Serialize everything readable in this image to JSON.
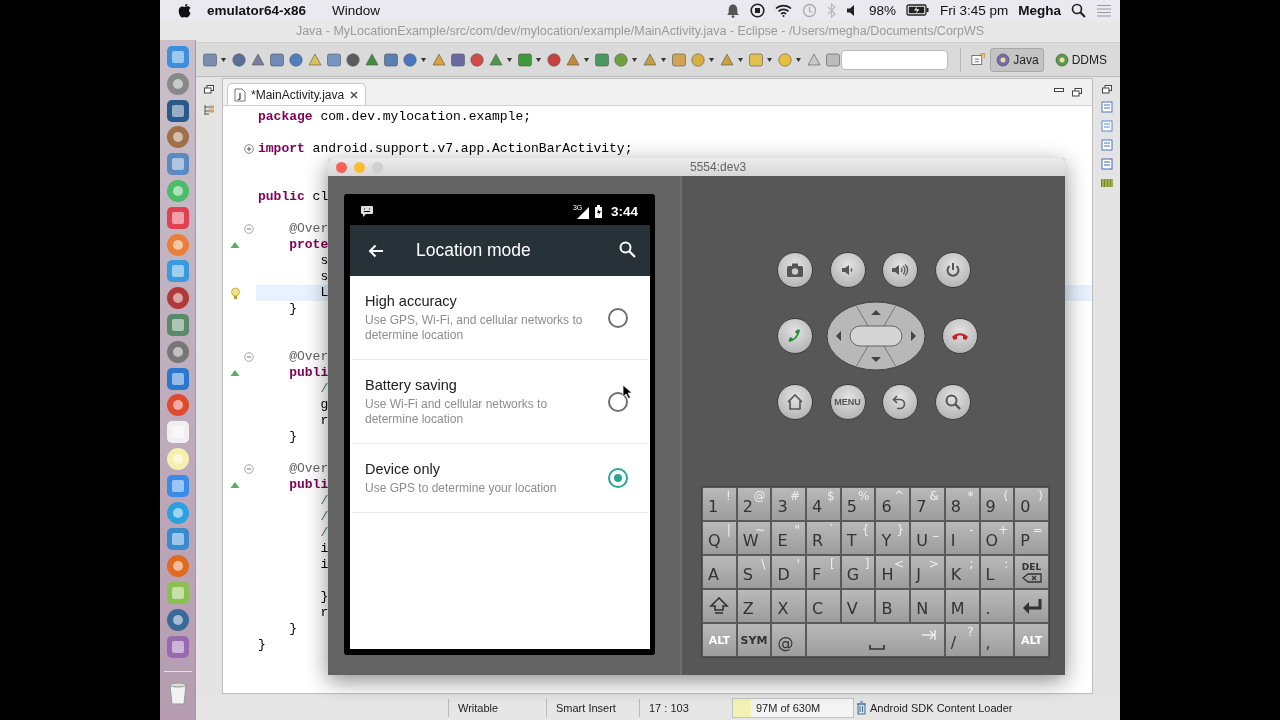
{
  "menu_bar": {
    "app_name": "emulator64-x86",
    "menus": [
      "Window"
    ],
    "battery": "98%",
    "clock": "Fri 3:45 pm",
    "user": "Megha"
  },
  "eclipse": {
    "title": "Java - MyLocationExample/src/com/dev/mylocation/example/MainActivity.java - Eclipse - /Users/megha/Documents/CorpWS",
    "perspectives": [
      {
        "label": "Java",
        "selected": true
      },
      {
        "label": "DDMS",
        "selected": false
      }
    ],
    "editor_tab": {
      "label": "*MainActivity.java"
    },
    "code_lines": [
      {
        "kind": "code",
        "text": "**package** com.dev.mylocation.example;",
        "current": false
      },
      {
        "kind": "blank",
        "current": false
      },
      {
        "kind": "code",
        "text": "**import** android.support.v7.app.ActionBarActivity;",
        "folded": true,
        "current": false
      },
      {
        "kind": "blank",
        "current": false
      },
      {
        "kind": "blank",
        "current": false
      },
      {
        "kind": "code",
        "text": "**public** cl",
        "current": false
      },
      {
        "kind": "blank",
        "current": false
      },
      {
        "kind": "annotation",
        "text": "    @Over",
        "folded": false,
        "current": false
      },
      {
        "kind": "code",
        "text": "    **prote**",
        "override": true,
        "current": false
      },
      {
        "kind": "code",
        "text": "        s",
        "current": false
      },
      {
        "kind": "code",
        "text": "        s",
        "current": false
      },
      {
        "kind": "code",
        "text": "        L",
        "warning": true,
        "current": true
      },
      {
        "kind": "code",
        "text": "    }",
        "current": false
      },
      {
        "kind": "blank",
        "current": false
      },
      {
        "kind": "blank",
        "current": false
      },
      {
        "kind": "annotation",
        "text": "    @Over",
        "folded": false,
        "current": false
      },
      {
        "kind": "code",
        "text": "    **publi**",
        "override": true,
        "current": false
      },
      {
        "kind": "comment",
        "text": "        /",
        "current": false
      },
      {
        "kind": "code",
        "text": "        g",
        "current": false
      },
      {
        "kind": "code",
        "text": "        r",
        "current": false
      },
      {
        "kind": "code",
        "text": "    }",
        "current": false
      },
      {
        "kind": "blank",
        "current": false
      },
      {
        "kind": "annotation",
        "text": "    @Over",
        "folded": false,
        "current": false
      },
      {
        "kind": "code",
        "text": "    **publi**",
        "override": true,
        "current": false
      },
      {
        "kind": "comment",
        "text": "        /",
        "current": false
      },
      {
        "kind": "comment",
        "text": "        /",
        "current": false
      },
      {
        "kind": "comment",
        "text": "        /",
        "current": false
      },
      {
        "kind": "code",
        "text": "        i",
        "current": false
      },
      {
        "kind": "code",
        "text": "        i",
        "current": false
      },
      {
        "kind": "blank",
        "current": false
      },
      {
        "kind": "code",
        "text": "        }",
        "current": false
      },
      {
        "kind": "code",
        "text": "        r",
        "current": false
      },
      {
        "kind": "code",
        "text": "    }",
        "current": false
      },
      {
        "kind": "code",
        "text": "}",
        "current": false
      }
    ],
    "status_bar": {
      "fields": [
        "Writable",
        "Smart Insert",
        "17 : 103"
      ],
      "heap": {
        "text": "97M of 630M",
        "level": 0.15
      },
      "job": "Android SDK Content Loader"
    }
  },
  "emulator": {
    "title": "5554:dev3",
    "phone": {
      "network": "3G",
      "time": "3:44",
      "app_bar_title": "Location mode",
      "options": [
        {
          "title": "High accuracy",
          "summary": "Use GPS, Wi-Fi, and cellular networks to determine location",
          "selected": false
        },
        {
          "title": "Battery saving",
          "summary": "Use Wi-Fi and cellular networks to determine location",
          "selected": false
        },
        {
          "title": "Device only",
          "summary": "Use GPS to determine your location",
          "selected": true
        }
      ]
    },
    "menu_key": "MENU",
    "keyboard": {
      "rows": [
        {
          "keys": [
            {
              "kind": "char",
              "label": "1",
              "alt": "!"
            },
            {
              "kind": "char",
              "label": "2",
              "alt": "@"
            },
            {
              "kind": "char",
              "label": "3",
              "alt": "#"
            },
            {
              "kind": "char",
              "label": "4",
              "alt": "$"
            },
            {
              "kind": "char",
              "label": "5",
              "alt": "%"
            },
            {
              "kind": "char",
              "label": "6",
              "alt": "^"
            },
            {
              "kind": "char",
              "label": "7",
              "alt": "&"
            },
            {
              "kind": "char",
              "label": "8",
              "alt": "*"
            },
            {
              "kind": "char",
              "label": "9",
              "alt": "("
            },
            {
              "kind": "char",
              "label": "0",
              "alt": ")"
            }
          ]
        },
        {
          "keys": [
            {
              "kind": "char",
              "label": "Q",
              "alt": "|"
            },
            {
              "kind": "char",
              "label": "W",
              "alt": "~"
            },
            {
              "kind": "char",
              "label": "E",
              "alt": "\""
            },
            {
              "kind": "char",
              "label": "R",
              "alt": "`"
            },
            {
              "kind": "char",
              "label": "T",
              "alt": "{"
            },
            {
              "kind": "char",
              "label": "Y",
              "alt": "}"
            },
            {
              "kind": "char",
              "label": "U",
              "alt": "_"
            },
            {
              "kind": "char",
              "label": "I",
              "alt": "-"
            },
            {
              "kind": "char",
              "label": "O",
              "alt": "+"
            },
            {
              "kind": "char",
              "label": "P",
              "alt": "="
            }
          ]
        },
        {
          "keys": [
            {
              "kind": "char",
              "label": "A"
            },
            {
              "kind": "char",
              "label": "S",
              "alt": "\\"
            },
            {
              "kind": "char",
              "label": "D",
              "alt": "'"
            },
            {
              "kind": "char",
              "label": "F",
              "alt": "["
            },
            {
              "kind": "char",
              "label": "G",
              "alt": "]"
            },
            {
              "kind": "char",
              "label": "H",
              "alt": "<"
            },
            {
              "kind": "char",
              "label": "J",
              "alt": ">"
            },
            {
              "kind": "char",
              "label": "K",
              "alt": ";"
            },
            {
              "kind": "char",
              "label": "L",
              "alt": ":"
            },
            {
              "kind": "del",
              "label": "DEL"
            }
          ]
        },
        {
          "keys": [
            {
              "kind": "shift"
            },
            {
              "kind": "char",
              "label": "Z"
            },
            {
              "kind": "char",
              "label": "X"
            },
            {
              "kind": "char",
              "label": "C"
            },
            {
              "kind": "char",
              "label": "V"
            },
            {
              "kind": "char",
              "label": "B"
            },
            {
              "kind": "char",
              "label": "N"
            },
            {
              "kind": "char",
              "label": "M"
            },
            {
              "kind": "char",
              "label": "."
            },
            {
              "kind": "enter"
            }
          ]
        },
        {
          "keys": [
            {
              "kind": "mod",
              "label": "ALT"
            },
            {
              "kind": "mod",
              "label": "SYM"
            },
            {
              "kind": "char",
              "label": "@"
            },
            {
              "kind": "space"
            },
            {
              "kind": "char",
              "label": "/",
              "alt": "?"
            },
            {
              "kind": "char",
              "label": ","
            },
            {
              "kind": "mod",
              "label": "ALT"
            }
          ]
        }
      ]
    }
  }
}
